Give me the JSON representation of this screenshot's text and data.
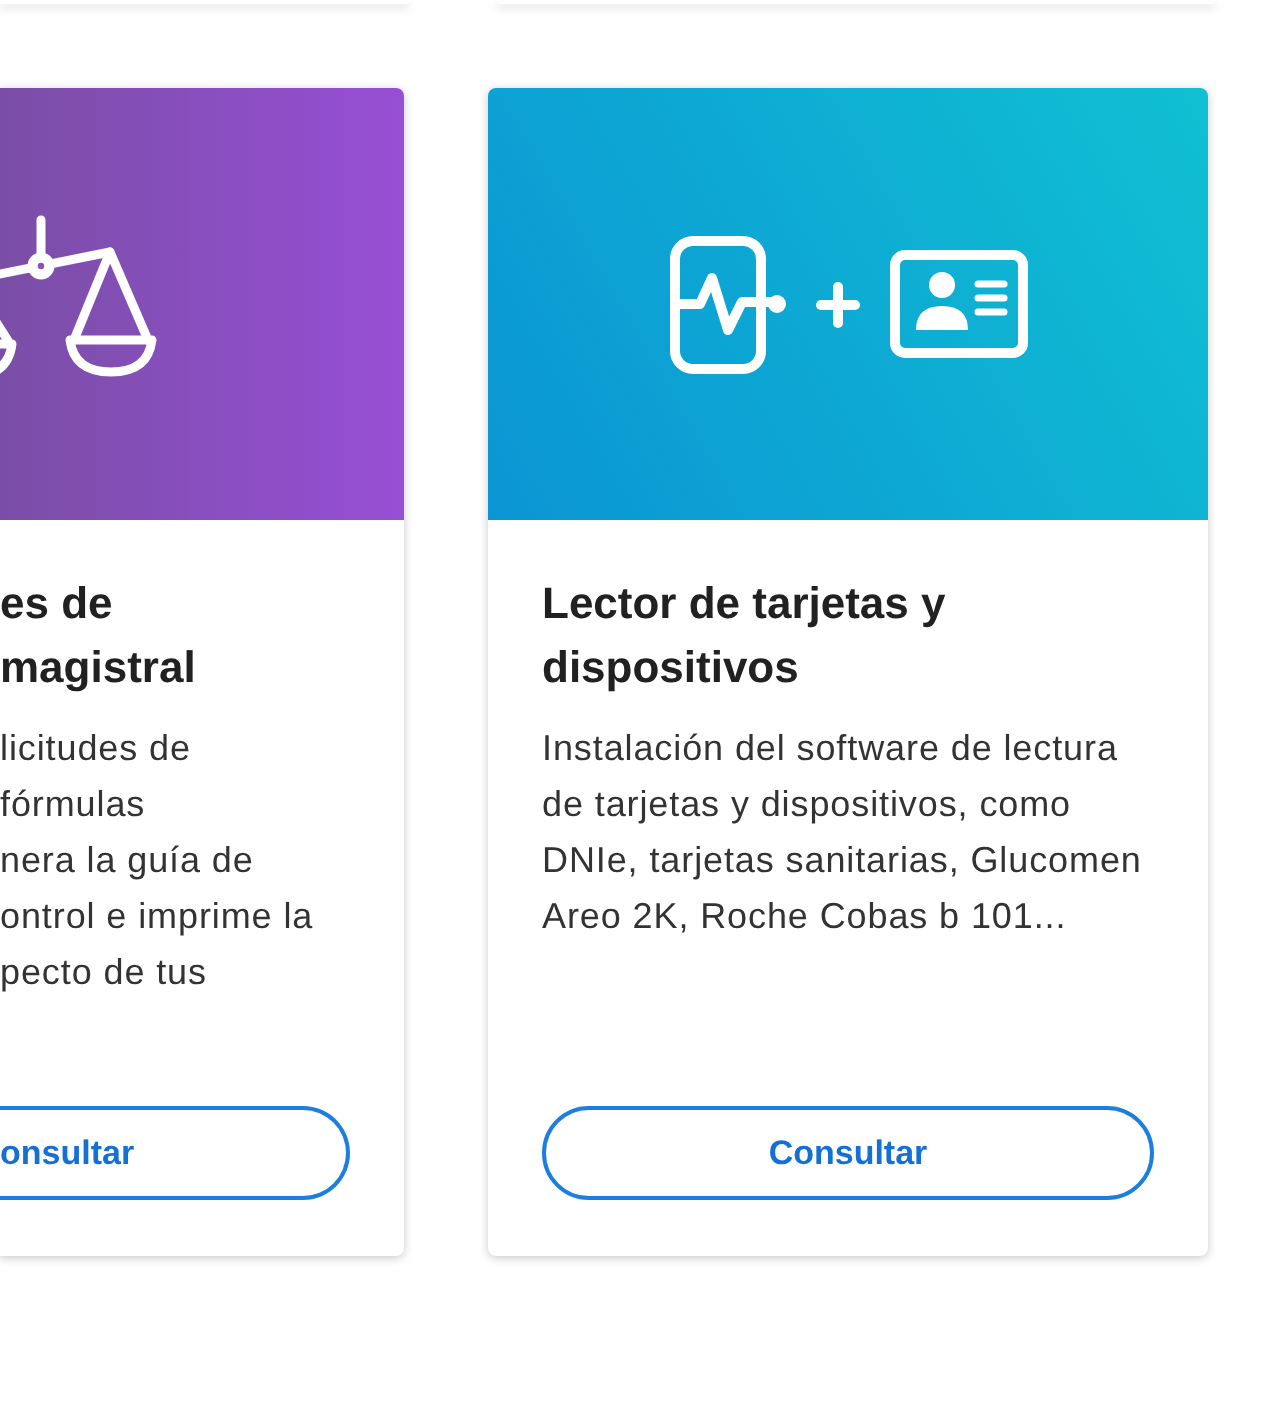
{
  "cards": [
    {
      "kind": "scale",
      "title": "es de\nmagistral",
      "description": "licitudes de\nfórmulas\nnera la guía de\nontrol e imprime la\npecto de tus",
      "button": "onsultar"
    },
    {
      "kind": "card-reader",
      "title": "Lector de tarjetas y dispositivos",
      "description": "Instalación del software de lectura de tarjetas y dispositivos, como DNIe, tarjetas sanitarias, Glucomen Areo 2K, Roche Cobas b 101...",
      "button": "Consultar"
    }
  ]
}
